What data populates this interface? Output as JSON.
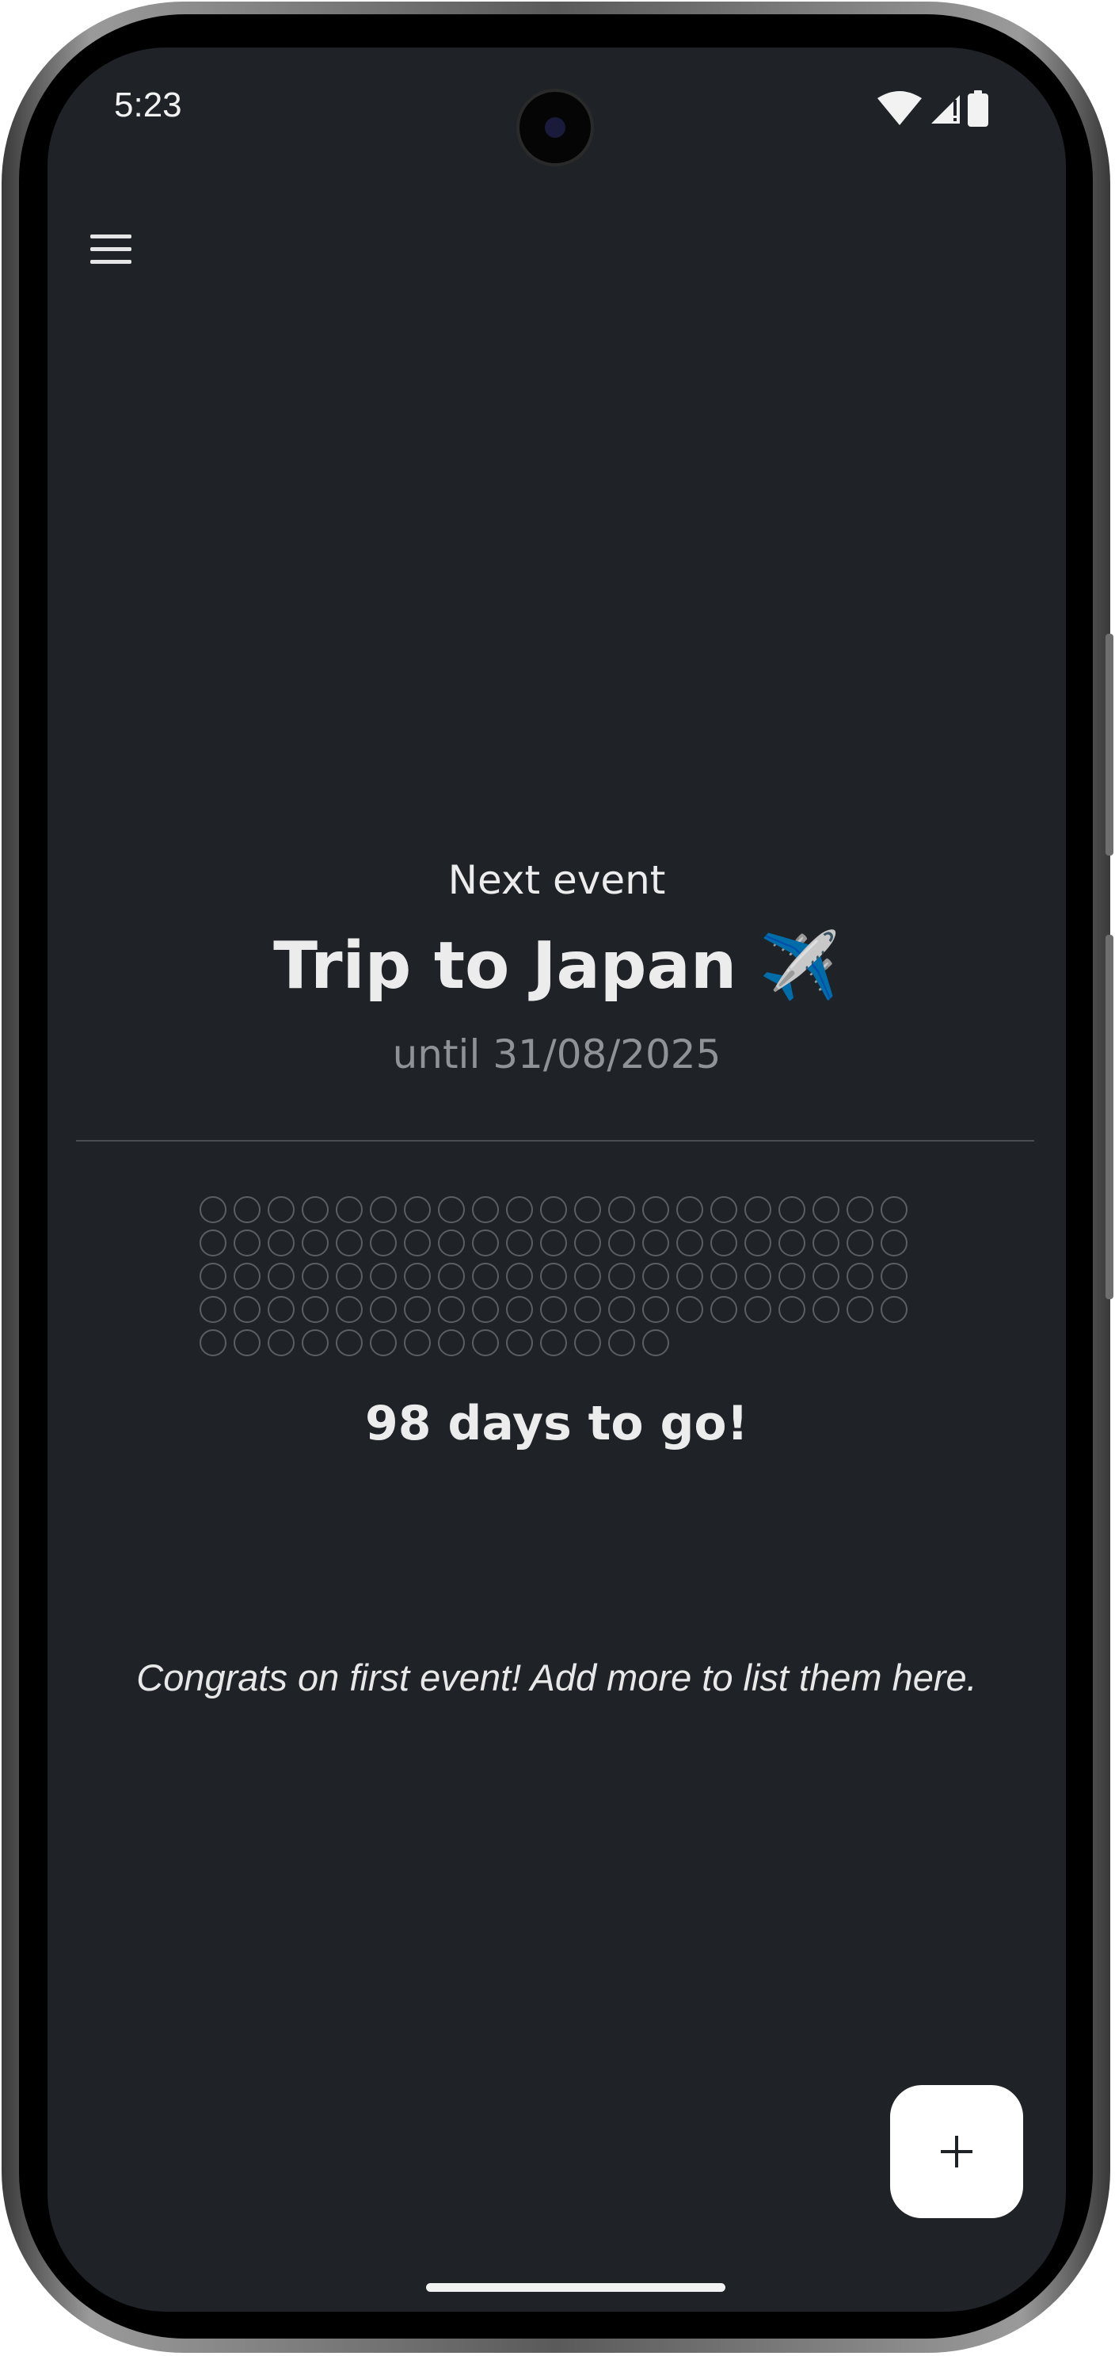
{
  "status_bar": {
    "time": "5:23",
    "icons": [
      "wifi-icon",
      "signal-icon",
      "battery-icon"
    ]
  },
  "toolbar": {
    "menu_icon": "hamburger-menu-icon"
  },
  "next_event": {
    "heading": "Next event",
    "title": "Trip to Japan ✈️",
    "date_text": "until 31/08/2025"
  },
  "countdown": {
    "days_remaining": 98,
    "label": "98 days to go!"
  },
  "empty_state": {
    "message": "Congrats on first event! Add more to list them here."
  },
  "fab": {
    "icon": "plus-icon"
  },
  "colors": {
    "background": "#1f2227",
    "text_primary": "#ececec",
    "text_secondary": "#8f9296",
    "dot_outline": "#5b5e63",
    "fab_background": "#ffffff"
  }
}
